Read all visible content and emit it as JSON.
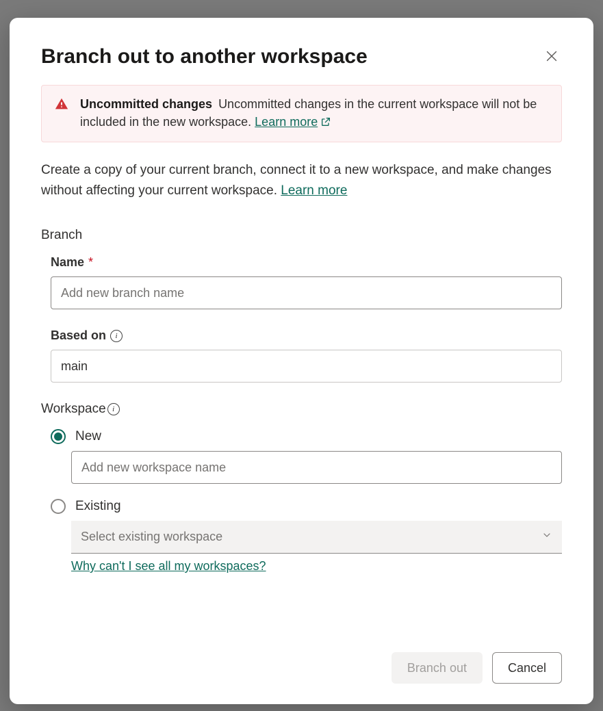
{
  "dialog": {
    "title": "Branch out to another workspace",
    "alert": {
      "heading": "Uncommitted changes",
      "body": "Uncommitted changes in the current workspace will not be included in the new workspace.",
      "learn_more": "Learn more"
    },
    "description": "Create a copy of your current branch, connect it to a new workspace, and make changes without affecting your current workspace.",
    "description_learn_more": "Learn more"
  },
  "branch": {
    "section_label": "Branch",
    "name_label": "Name",
    "name_placeholder": "Add new branch name",
    "name_value": "",
    "based_on_label": "Based on",
    "based_on_value": "main"
  },
  "workspace": {
    "section_label": "Workspace",
    "new_label": "New",
    "new_placeholder": "Add new workspace name",
    "new_value": "",
    "existing_label": "Existing",
    "existing_placeholder": "Select existing workspace",
    "help_link": "Why can't I see all my workspaces?",
    "selected": "new"
  },
  "actions": {
    "primary": "Branch out",
    "secondary": "Cancel"
  }
}
